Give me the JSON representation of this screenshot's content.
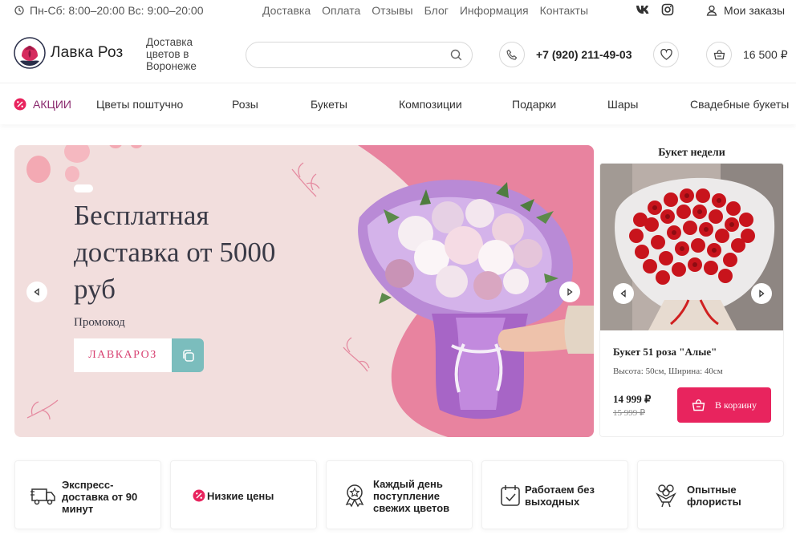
{
  "topbar": {
    "hours": "Пн-Сб: 8:00–20:00 Вс: 9:00–20:00",
    "nav": [
      "Доставка",
      "Оплата",
      "Отзывы",
      "Блог",
      "Информация",
      "Контакты"
    ],
    "socials": [
      "vk-icon",
      "instagram-icon"
    ],
    "orders_label": "Мои заказы"
  },
  "header": {
    "logo_text": "Лавка Роз",
    "tagline": "Доставка цветов в Воронеже",
    "search_placeholder": "",
    "phone": "+7 (920) 211-49-03",
    "cart_total": "16 500 ₽"
  },
  "categories": {
    "promo_label": "АКЦИИ",
    "items": [
      "Цветы поштучно",
      "Розы",
      "Букеты",
      "Композиции",
      "Подарки",
      "Шары",
      "Свадебные букеты"
    ]
  },
  "hero": {
    "title": "Бесплатная доставка от 5000 руб",
    "promo_label": "Промокод",
    "promo_code": "ЛАВКАРОЗ"
  },
  "bouquet_of_week": {
    "section_title": "Букет недели",
    "name": "Букет 51 роза \"Алые\"",
    "size": "Высота: 50см, Ширина: 40см",
    "price": "14 999 ₽",
    "old_price": "15 999 ₽",
    "cart_button": "В корзину"
  },
  "features": [
    {
      "icon": "delivery-truck-icon",
      "text": "Экспресс-доставка от 90 минут"
    },
    {
      "icon": "discount-icon",
      "text": "Низкие цены"
    },
    {
      "icon": "award-icon",
      "text": "Каждый день поступление свежих цветов"
    },
    {
      "icon": "calendar-check-icon",
      "text": "Работаем без выходных"
    },
    {
      "icon": "bouquet-icon",
      "text": "Опытные флористы"
    }
  ],
  "colors": {
    "accent": "#e8245e",
    "hero_bg": "#f2dedd",
    "hero_pink": "#e8839f",
    "copy_button": "#7bbdbd"
  }
}
